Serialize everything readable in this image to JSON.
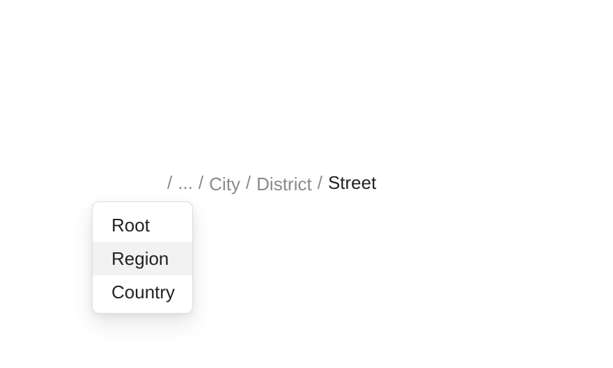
{
  "breadcrumb": {
    "separator": "/",
    "ellipsis": "...",
    "items": [
      "City",
      "District"
    ],
    "current": "Street"
  },
  "dropdown": {
    "items": [
      "Root",
      "Region",
      "Country"
    ],
    "highlighted_index": 1
  }
}
